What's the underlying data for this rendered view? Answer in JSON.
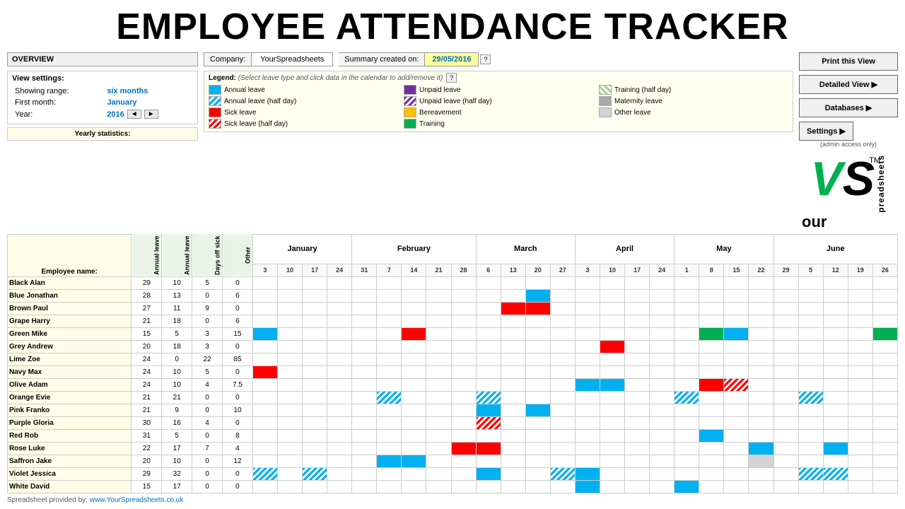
{
  "title": "EMPLOYEE ATTENDANCE TRACKER",
  "header": {
    "overview_label": "OVERVIEW",
    "company_label": "Company:",
    "company_value": "YourSpreadsheets",
    "summary_label": "Summary created on:",
    "summary_date": "29/05/2016",
    "help": "?"
  },
  "view_settings": {
    "label": "View settings:",
    "showing_range_label": "Showing range:",
    "showing_range_value": "six months",
    "first_month_label": "First month:",
    "first_month_value": "January",
    "year_label": "Year:",
    "year_value": "2016"
  },
  "yearly_stats_label": "Yearly statistics:",
  "legend": {
    "title": "Legend:",
    "hint": "(Select leave type and click data in the calendar to add/remove it)",
    "items": [
      {
        "label": "Annual leave",
        "type": "annual"
      },
      {
        "label": "Annual leave (half day)",
        "type": "annual-half"
      },
      {
        "label": "Sick leave",
        "type": "sick"
      },
      {
        "label": "Sick leave (half day)",
        "type": "sick-half"
      },
      {
        "label": "Unpaid leave",
        "type": "unpaid"
      },
      {
        "label": "Unpaid leave (half day)",
        "type": "unpaid-half"
      },
      {
        "label": "Bereavement",
        "type": "bereavement"
      },
      {
        "label": "Training",
        "type": "training"
      },
      {
        "label": "Training (half day)",
        "type": "training-half"
      },
      {
        "label": "Maternity leave",
        "type": "maternity"
      },
      {
        "label": "Other leave",
        "type": "other"
      }
    ]
  },
  "buttons": {
    "print": "Print this View",
    "detailed": "Detailed View ▶",
    "databases": "Databases ▶",
    "settings": "Settings ▶",
    "settings_sub": "(admin access only)"
  },
  "columns": {
    "employee": "Employee name:",
    "annual_allowance": "Annual leave allowance",
    "annual_taken": "Annual leave taken",
    "days_off_sick": "Days off sick",
    "other": "Other"
  },
  "months": [
    {
      "name": "January",
      "dates": [
        "3",
        "10",
        "17",
        "24"
      ]
    },
    {
      "name": "February",
      "dates": [
        "31",
        "7",
        "14",
        "21",
        "28"
      ]
    },
    {
      "name": "March",
      "dates": [
        "6",
        "13",
        "20",
        "27"
      ]
    },
    {
      "name": "April",
      "dates": [
        "3",
        "10",
        "17",
        "24"
      ]
    },
    {
      "name": "May",
      "dates": [
        "1",
        "8",
        "15",
        "22"
      ]
    },
    {
      "name": "June",
      "dates": [
        "29",
        "5",
        "12",
        "19",
        "26"
      ]
    }
  ],
  "employees": [
    {
      "name": "Black Alan",
      "allowance": 29,
      "taken": 10,
      "sick": 5,
      "other": 0
    },
    {
      "name": "Blue Jonathan",
      "allowance": 28,
      "taken": 13,
      "sick": 0,
      "other": 6
    },
    {
      "name": "Brown Paul",
      "allowance": 27,
      "taken": 11,
      "sick": 9,
      "other": 0
    },
    {
      "name": "Grape Harry",
      "allowance": 21,
      "taken": 18,
      "sick": 0,
      "other": 6
    },
    {
      "name": "Green Mike",
      "allowance": 15,
      "taken": 5,
      "sick": 3,
      "other": 15
    },
    {
      "name": "Grey Andrew",
      "allowance": 20,
      "taken": 18,
      "sick": 3,
      "other": 0
    },
    {
      "name": "Lime Zoe",
      "allowance": 24,
      "taken": 0,
      "sick": 22,
      "other": 85
    },
    {
      "name": "Navy Max",
      "allowance": 24,
      "taken": 10,
      "sick": 5,
      "other": 0
    },
    {
      "name": "Olive Adam",
      "allowance": 24,
      "taken": 10,
      "sick": 4,
      "other": 7.5
    },
    {
      "name": "Orange Evie",
      "allowance": 21,
      "taken": 21,
      "sick": 0,
      "other": 0
    },
    {
      "name": "Pink Franko",
      "allowance": 21,
      "taken": 9,
      "sick": 0,
      "other": 10
    },
    {
      "name": "Purple Gloria",
      "allowance": 30,
      "taken": 16,
      "sick": 4,
      "other": 0
    },
    {
      "name": "Red Rob",
      "allowance": 31,
      "taken": 5,
      "sick": 0,
      "other": 8
    },
    {
      "name": "Rose Luke",
      "allowance": 22,
      "taken": 17,
      "sick": 7,
      "other": 4
    },
    {
      "name": "Saffron Jake",
      "allowance": 20,
      "taken": 10,
      "sick": 0,
      "other": 12
    },
    {
      "name": "Violet Jessica",
      "allowance": 29,
      "taken": 32,
      "sick": 0,
      "other": 0
    },
    {
      "name": "White David",
      "allowance": 15,
      "taken": 17,
      "sick": 0,
      "other": 0
    }
  ],
  "footer": {
    "text": "Spreadsheet provided by:",
    "url": "www.YourSpreadsheets.co.uk"
  }
}
